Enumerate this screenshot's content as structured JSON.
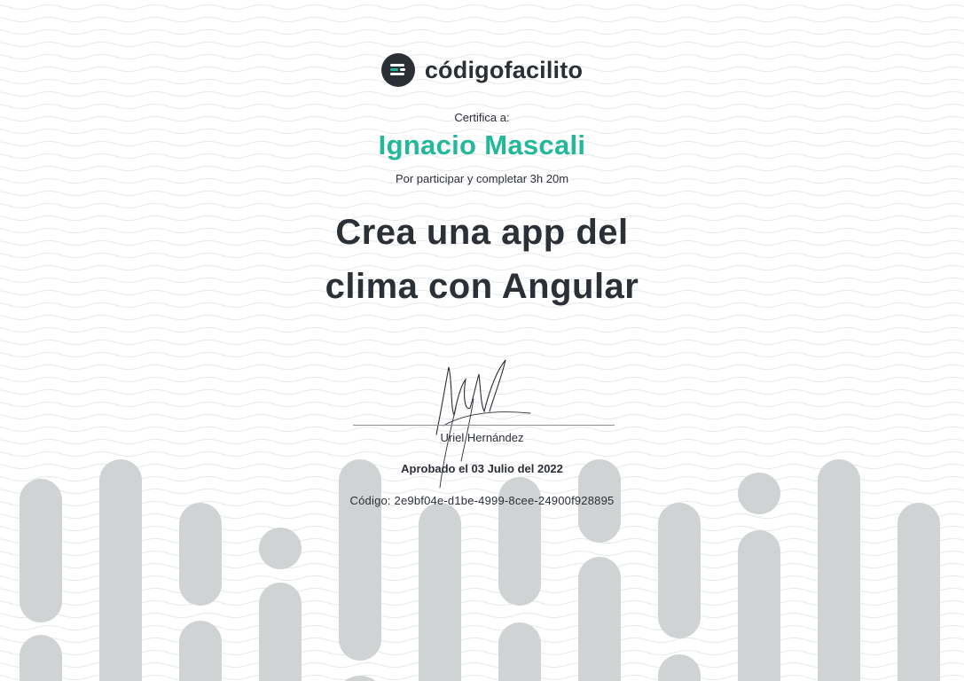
{
  "brand": {
    "name": "códigofacilito",
    "icon": "codigofacilito-logo-icon"
  },
  "certificate": {
    "intro": "Certifica a:",
    "student_name": "Ignacio Mascali",
    "participation": "Por participar y completar 3h 20m",
    "course_title_line1": "Crea una app del",
    "course_title_line2": "clima con Angular",
    "signer": "Uriel Hernández",
    "approved": "Aprobado el 03 Julio del 2022",
    "code": "Código: 2e9bf04e-d1be-4999-8cee-24900f928895"
  },
  "colors": {
    "accent": "#22b899",
    "text": "#2b2f36",
    "pill": "#cfd3d3",
    "wave": "#e6e8ea",
    "background": "#ffffff"
  }
}
